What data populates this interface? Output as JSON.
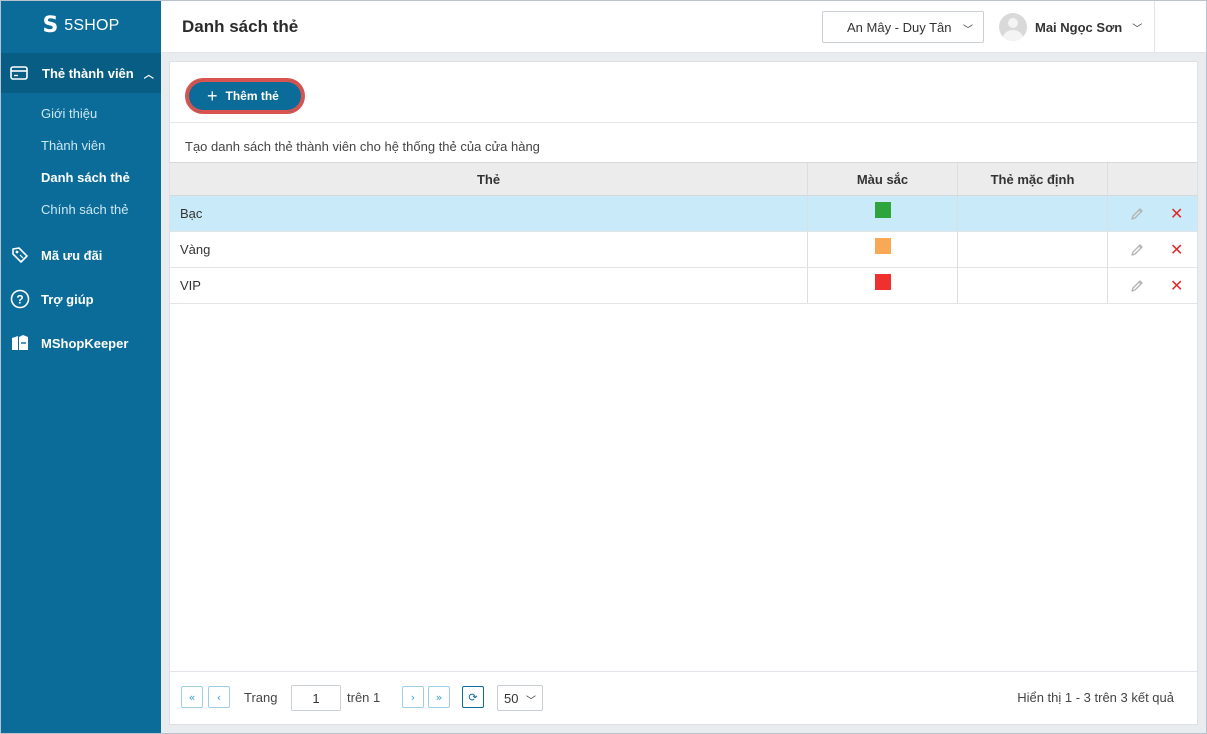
{
  "brand": {
    "logo_mark": "S",
    "name": "5SHOP"
  },
  "sidebar": {
    "section": {
      "label": "Thẻ thành viên",
      "icon": "card-icon"
    },
    "subitems": [
      {
        "label": "Giới thiệu"
      },
      {
        "label": "Thành viên"
      },
      {
        "label": "Danh sách thẻ",
        "active": true
      },
      {
        "label": "Chính sách thẻ"
      }
    ],
    "items": [
      {
        "label": "Mã ưu đãi",
        "icon": "tag-icon"
      },
      {
        "label": "Trợ giúp",
        "icon": "help-icon"
      },
      {
        "label": "MShopKeeper",
        "icon": "shop-icon"
      }
    ]
  },
  "header": {
    "title": "Danh sách thẻ",
    "store": "An Mây - Duy Tân",
    "user": "Mai Ngọc Sơn"
  },
  "toolbar": {
    "add_label": "Thêm thẻ",
    "description": "Tạo danh sách thẻ thành viên cho hệ thống thẻ của cửa hàng"
  },
  "table": {
    "columns": [
      "Thẻ",
      "Màu sắc",
      "Thẻ mặc định",
      ""
    ],
    "rows": [
      {
        "name": "Bạc",
        "color": "#2ea43c",
        "selected": true
      },
      {
        "name": "Vàng",
        "color": "#f9a956",
        "selected": false
      },
      {
        "name": "VIP",
        "color": "#f0302f",
        "selected": false
      }
    ]
  },
  "pager": {
    "page_label": "Trang",
    "page_value": "1",
    "of_label": "trên 1",
    "page_size": "50",
    "result": "Hiển thị 1 - 3 trên 3 kết quả"
  },
  "colors": {
    "accent": "#0b6c99",
    "sidebar": "#0b6c99",
    "selected_row": "#c9eaf8",
    "delete": "#e02b2b"
  }
}
